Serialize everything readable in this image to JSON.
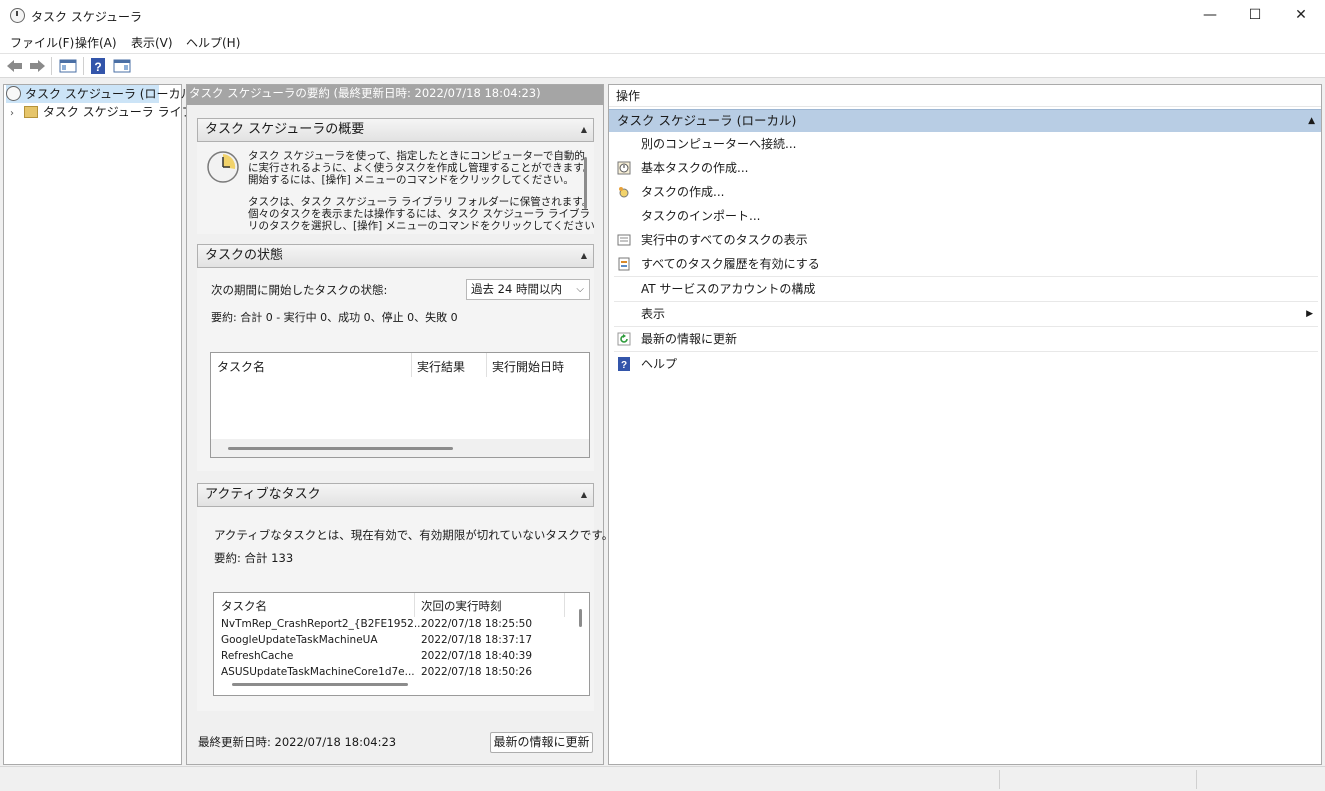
{
  "window": {
    "title": "タスク スケジューラ",
    "minimize": "—",
    "maximize": "☐",
    "close": "✕"
  },
  "menu": [
    "ファイル(F)",
    "操作(A)",
    "表示(V)",
    "ヘルプ(H)"
  ],
  "tree": {
    "root": "タスク スケジューラ (ローカル)",
    "child": "タスク スケジューラ ライブラリ"
  },
  "middle": {
    "header": "タスク スケジューラの要約 (最終更新日時: 2022/07/18 18:04:23)",
    "overview": {
      "title": "タスク スケジューラの概要",
      "lines": [
        "タスク スケジューラを使って、指定したときにコンピューターで自動的",
        "に実行されるように、よく使うタスクを作成し管理することができます。",
        "開始するには、[操作] メニューのコマンドをクリックしてください。",
        "",
        "タスクは、タスク スケジューラ ライブラリ フォルダーに保管されます。",
        "個々のタスクを表示または操作するには、タスク スケジューラ ライブラ",
        "リのタスクを選択し、[操作] メニューのコマンドをクリックしてください。"
      ]
    },
    "status": {
      "title": "タスクの状態",
      "period_label": "次の期間に開始したタスクの状態:",
      "period_value": "過去 24 時間以内",
      "summary": "要約: 合計 0 - 実行中 0、成功 0、停止 0、失敗 0",
      "columns": [
        "タスク名",
        "実行結果",
        "実行開始日時"
      ]
    },
    "active": {
      "title": "アクティブなタスク",
      "desc": "アクティブなタスクとは、現在有効で、有効期限が切れていないタスクです。",
      "summary": "要約: 合計 133",
      "columns": [
        "タスク名",
        "次回の実行時刻"
      ],
      "rows": [
        {
          "name": "NvTmRep_CrashReport2_{B2FE1952...",
          "time": "2022/07/18 18:25:50"
        },
        {
          "name": "GoogleUpdateTaskMachineUA",
          "time": "2022/07/18 18:37:17"
        },
        {
          "name": "RefreshCache",
          "time": "2022/07/18 18:40:39"
        },
        {
          "name": "ASUSUpdateTaskMachineCore1d7e...",
          "time": "2022/07/18 18:50:26"
        }
      ]
    },
    "footer": {
      "last_updated": "最終更新日時: 2022/07/18 18:04:23",
      "refresh_button": "最新の情報に更新"
    }
  },
  "actions": {
    "header": "操作",
    "selected": "タスク スケジューラ (ローカル)",
    "items": [
      "別のコンピューターへ接続...",
      "基本タスクの作成...",
      "タスクの作成...",
      "タスクのインポート...",
      "実行中のすべてのタスクの表示",
      "すべてのタスク履歴を有効にする",
      "AT サービスのアカウントの構成",
      "表示",
      "最新の情報に更新",
      "ヘルプ"
    ]
  }
}
